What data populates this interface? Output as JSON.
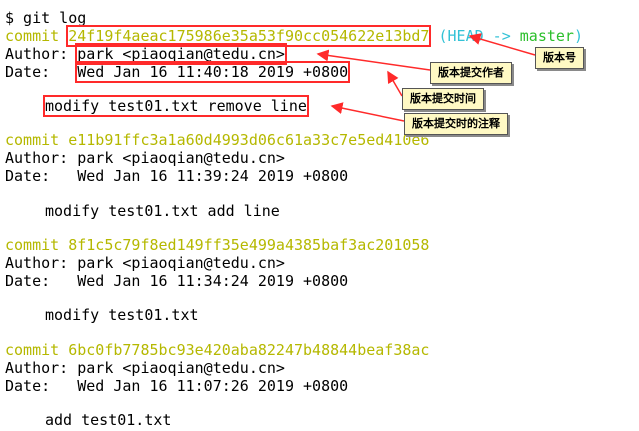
{
  "terminal": {
    "prompt": "$ git log",
    "commits": [
      {
        "keyword": "commit",
        "hash": "24f19f4aeac175986e35a53f90cc054622e13bd7",
        "ref_open": "(",
        "ref_head": "HEAD -> ",
        "ref_branch": "master",
        "ref_close": ")",
        "author_label": "Author:",
        "author": "park <piaoqian@tedu.cn>",
        "date_label": "Date:",
        "date": "Wed Jan 16 11:40:18 2019 +0800",
        "message": "modify test01.txt remove line"
      },
      {
        "keyword": "commit",
        "hash": "e11b91ffc3a1a60d4993d06c61a33c7e5ed410e6",
        "author_label": "Author:",
        "author": "park <piaoqian@tedu.cn>",
        "date_label": "Date:",
        "date": "Wed Jan 16 11:39:24 2019 +0800",
        "message": "modify test01.txt add line"
      },
      {
        "keyword": "commit",
        "hash": "8f1c5c79f8ed149ff35e499a4385baf3ac201058",
        "author_label": "Author:",
        "author": "park <piaoqian@tedu.cn>",
        "date_label": "Date:",
        "date": "Wed Jan 16 11:34:24 2019 +0800",
        "message": "modify test01.txt"
      },
      {
        "keyword": "commit",
        "hash": "6bc0fb7785bc93e420aba82247b48844beaf38ac",
        "author_label": "Author:",
        "author": "park <piaoqian@tedu.cn>",
        "date_label": "Date:",
        "date": "Wed Jan 16 11:07:26 2019 +0800",
        "message": "add test01.txt"
      }
    ]
  },
  "annotations": {
    "version": "版本号",
    "author": "版本提交作者",
    "time": "版本提交时间",
    "message": "版本提交时的注释"
  },
  "colors": {
    "commit_line": "#b5b800",
    "head_ref": "#33c2d6",
    "branch": "#2bbf2b",
    "highlight_box": "#ff2a2a",
    "annotation_bg": "#fff9c4"
  }
}
